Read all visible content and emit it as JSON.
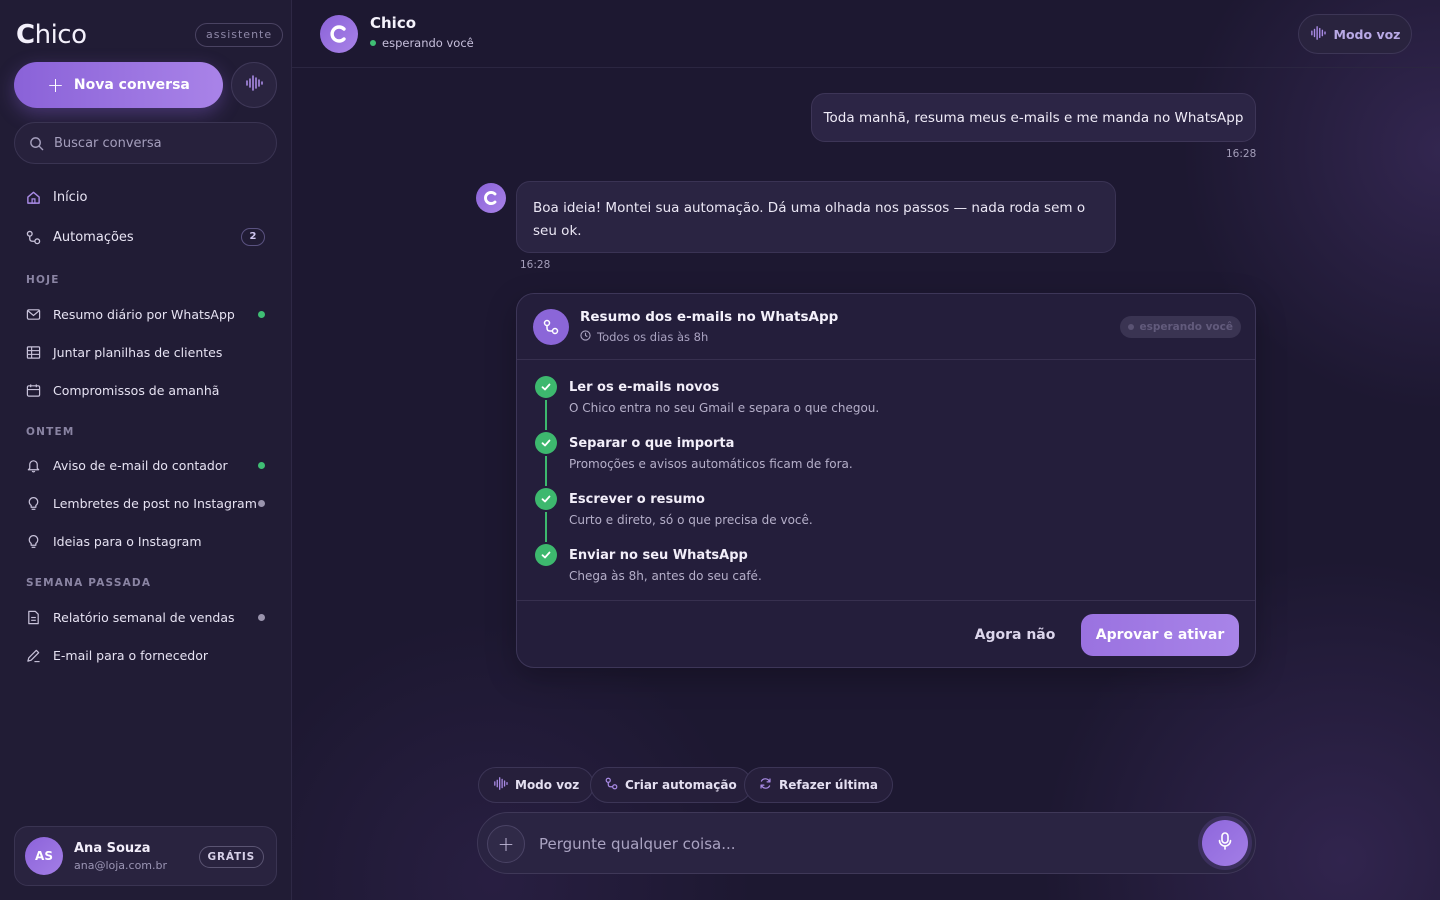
{
  "brand": {
    "name_bold": "C",
    "name_rest": "hico",
    "badge": "assistente"
  },
  "sidebar": {
    "new_chat_label": "Nova conversa",
    "search_placeholder": "Buscar conversa",
    "nav": [
      {
        "label": "Início",
        "icon": "home-icon"
      },
      {
        "label": "Automações",
        "icon": "automation-icon",
        "count": "2"
      }
    ],
    "sections": [
      {
        "title": "HOJE",
        "items": [
          {
            "label": "Resumo diário por WhatsApp",
            "icon": "mail-icon",
            "dot": "#3fbe74"
          },
          {
            "label": "Juntar planilhas de clientes",
            "icon": "table-icon"
          },
          {
            "label": "Compromissos de amanhã",
            "icon": "calendar-icon"
          }
        ]
      },
      {
        "title": "ONTEM",
        "items": [
          {
            "label": "Aviso de e-mail do contador",
            "icon": "bell-icon",
            "dot": "#3fbe74"
          },
          {
            "label": "Lembretes de post no Instagram",
            "icon": "bulb-icon",
            "dot": "#9a94ad"
          },
          {
            "label": "Ideias para o Instagram",
            "icon": "bulb-icon"
          }
        ]
      },
      {
        "title": "SEMANA PASSADA",
        "items": [
          {
            "label": "Relatório semanal de vendas",
            "icon": "document-icon",
            "dot": "#9a94ad"
          },
          {
            "label": "E-mail para o fornecedor",
            "icon": "pen-icon"
          }
        ]
      }
    ],
    "user": {
      "initials": "AS",
      "name": "Ana Souza",
      "email": "ana@loja.com.br",
      "plan": "GRÁTIS"
    }
  },
  "header": {
    "title": "Chico",
    "status": "esperando você",
    "voice_mode": "Modo voz"
  },
  "messages": {
    "user_text": "Toda manhã, resuma meus e-mails e me manda no WhatsApp",
    "user_time": "16:28",
    "bot_avatar": "C",
    "bot_text": "Boa ideia! Montei sua automação. Dá uma olhada nos passos — nada roda sem o seu ok.",
    "bot_time": "16:28"
  },
  "card": {
    "title": "Resumo dos e-mails no WhatsApp",
    "schedule": "Todos os dias às 8h",
    "badge": "esperando você",
    "steps": [
      {
        "title": "Ler os e-mails novos",
        "desc": "O Chico entra no seu Gmail e separa o que chegou."
      },
      {
        "title": "Separar o que importa",
        "desc": "Promoções e avisos automáticos ficam de fora."
      },
      {
        "title": "Escrever o resumo",
        "desc": "Curto e direto, só o que precisa de você."
      },
      {
        "title": "Enviar no seu WhatsApp",
        "desc": "Chega às 8h, antes do seu café."
      }
    ],
    "secondary": "Agora não",
    "primary": "Aprovar e ativar"
  },
  "chips": [
    {
      "label": "Modo voz",
      "icon": "waveform-icon"
    },
    {
      "label": "Criar automação",
      "icon": "automation-icon"
    },
    {
      "label": "Refazer última",
      "icon": "refresh-icon"
    }
  ],
  "composer": {
    "placeholder": "Pergunte qualquer coisa..."
  },
  "colors": {
    "accent": "#9a72e0",
    "success": "#3db86e",
    "background": "#1d1831"
  }
}
